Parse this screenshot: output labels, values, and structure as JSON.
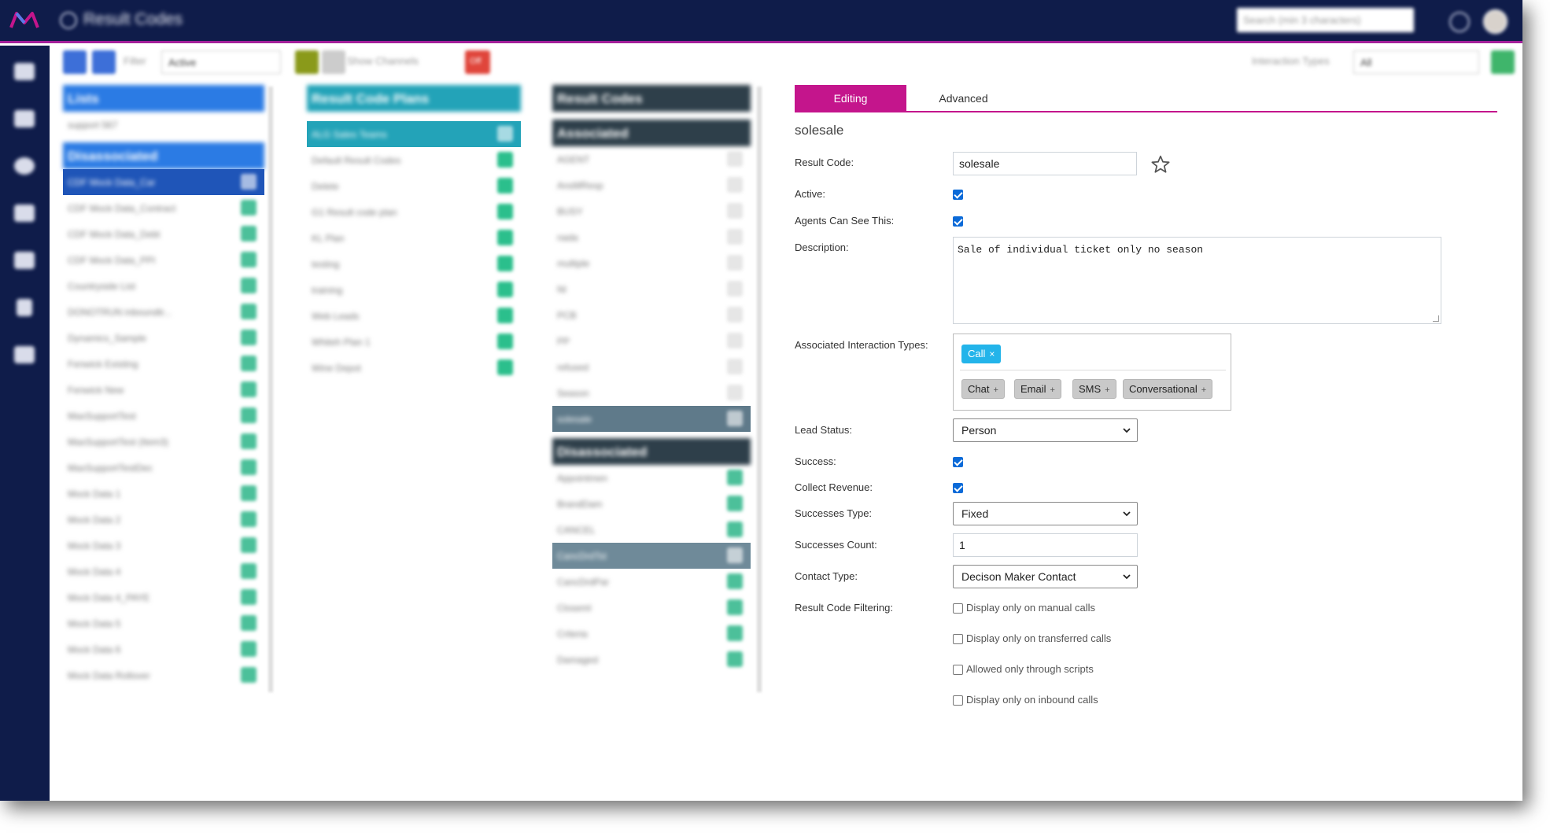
{
  "header": {
    "app_title": "Result Codes",
    "search_placeholder": "Search (min 3 characters)"
  },
  "toolbar": {
    "filter_label": "Filter",
    "filter_value": "Active",
    "show_channels_label": "Show Channels",
    "toggle_value": "Off",
    "interaction_types_label": "Interaction Types",
    "interaction_types_value": "All"
  },
  "lists_column": {
    "header": "Lists",
    "items": [
      "support 567"
    ],
    "disassociated_header": "Disassociated",
    "disassociated_items": [
      "CDF Mock Data_Car",
      "CDF Mock Data_Contract",
      "CDF Mock Data_Debt",
      "CDF Mock Data_PPI",
      "Countryside List",
      "DONOTRUN inboundtr...",
      "Dynamics_Sample",
      "Fenwick Existing",
      "Fenwick New",
      "MaxSupportTest",
      "MaxSupportTest (Item3)",
      "MaxSupportTestDec",
      "Mock Data 1",
      "Mock Data 2",
      "Mock Data 3",
      "Mock Data 4",
      "Mock Data 4_PAYE",
      "Mock Data 5",
      "Mock Data 6",
      "Mock Data Rollover"
    ]
  },
  "plans_column": {
    "header": "Result Code Plans",
    "items": [
      "ALG Sales Teams",
      "Default Result Codes",
      "Delete",
      "G1 Result code plan",
      "KL Plan",
      "testing",
      "training",
      "Web Leads",
      "Whiteh Plan 1",
      "Wine Depot"
    ]
  },
  "codes_column": {
    "header": "Result Codes",
    "associated_header": "Associated",
    "associated_items": [
      "AGENT",
      "AnsMResp",
      "BUSY",
      "nada",
      "multiple",
      "NI",
      "PCB",
      "PP",
      "refused",
      "Season",
      "solesale"
    ],
    "disassociated_header": "Disassociated",
    "disassociated_items": [
      "Appointmen",
      "BrandDam",
      "CANCEL",
      "CancDrdTst",
      "CancDrdPar",
      "Closeml",
      "Criteria",
      "Damaged"
    ]
  },
  "detail": {
    "tabs": [
      "Editing",
      "Advanced"
    ],
    "record_title": "solesale",
    "labels": {
      "result_code": "Result Code:",
      "active": "Active:",
      "agents_can_see": "Agents Can See This:",
      "description": "Description:",
      "associated_types": "Associated Interaction Types:",
      "lead_status": "Lead Status:",
      "success": "Success:",
      "collect_revenue": "Collect Revenue:",
      "successes_type": "Successes Type:",
      "successes_count": "Successes Count:",
      "contact_type": "Contact Type:",
      "filtering": "Result Code Filtering:"
    },
    "result_code_value": "solesale",
    "description_value": "Sale of individual ticket only no season",
    "active": true,
    "agents_can_see": true,
    "success": true,
    "collect_revenue": true,
    "selected_interaction_type": "Call",
    "available_interaction_types": [
      "Chat",
      "Email",
      "SMS",
      "Conversational"
    ],
    "lead_status_value": "Person",
    "successes_type_value": "Fixed",
    "successes_count_value": "1",
    "contact_type_value": "Decison Maker Contact",
    "filter_options": [
      "Display only on manual calls",
      "Display only on transferred calls",
      "Allowed only through scripts",
      "Display only on inbound calls"
    ]
  },
  "colors": {
    "nav_bg": "#0f1c4a",
    "accent_magenta": "#c4158c",
    "lists_blue": "#2b7be4",
    "plans_teal": "#23a3b8",
    "codes_dark": "#2e3f4a",
    "chip_blue": "#23b4ea",
    "checkbox_blue": "#0b6ad8"
  }
}
